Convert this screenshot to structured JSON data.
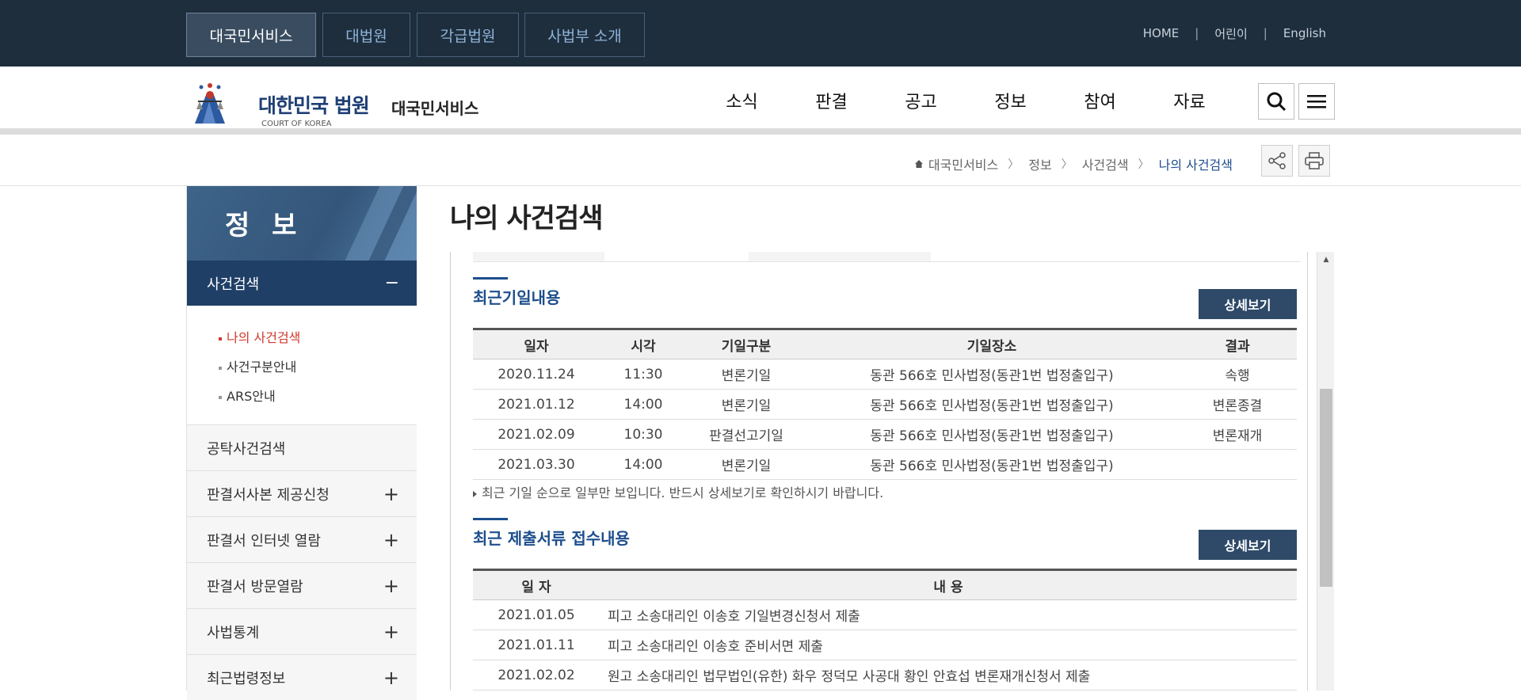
{
  "top_tabs": [
    "대국민서비스",
    "대법원",
    "각급법원",
    "사법부 소개"
  ],
  "utils": [
    "HOME",
    "어린이",
    "English"
  ],
  "logo": {
    "main": "대한민국 법원",
    "sub": "COURT OF KOREA",
    "service": "대국민서비스"
  },
  "gnb": [
    "소식",
    "판결",
    "공고",
    "정보",
    "참여",
    "자료"
  ],
  "breadcrumb": [
    "대국민서비스",
    "정보",
    "사건검색",
    "나의 사건검색"
  ],
  "sidebar": {
    "title": "정 보",
    "active": "사건검색",
    "active_toggle": "−",
    "sub_items": [
      "나의 사건검색",
      "사건구분안내",
      "ARS안내"
    ],
    "items": [
      {
        "label": "공탁사건검색",
        "toggle": ""
      },
      {
        "label": "판결서사본 제공신청",
        "toggle": "+"
      },
      {
        "label": "판결서 인터넷 열람",
        "toggle": "+"
      },
      {
        "label": "판결서 방문열람",
        "toggle": "+"
      },
      {
        "label": "사법통계",
        "toggle": "+"
      },
      {
        "label": "최근법령정보",
        "toggle": "+"
      }
    ]
  },
  "page_title": "나의 사건검색",
  "hearings": {
    "title": "최근기일내용",
    "button": "상세보기",
    "columns": [
      "일자",
      "시각",
      "기일구분",
      "기일장소",
      "결과"
    ],
    "rows": [
      [
        "2020.11.24",
        "11:30",
        "변론기일",
        "동관 566호 민사법정(동관1번 법정출입구)",
        "속행"
      ],
      [
        "2021.01.12",
        "14:00",
        "변론기일",
        "동관 566호 민사법정(동관1번 법정출입구)",
        "변론종결"
      ],
      [
        "2021.02.09",
        "10:30",
        "판결선고기일",
        "동관 566호 민사법정(동관1번 법정출입구)",
        "변론재개"
      ],
      [
        "2021.03.30",
        "14:00",
        "변론기일",
        "동관 566호 민사법정(동관1번 법정출입구)",
        ""
      ]
    ],
    "note": "최근 기일 순으로 일부만 보입니다. 반드시 상세보기로 확인하시기 바랍니다."
  },
  "filings": {
    "title": "최근 제출서류 접수내용",
    "button": "상세보기",
    "columns": [
      "일 자",
      "내 용"
    ],
    "rows": [
      [
        "2021.01.05",
        "피고 소송대리인 이송호 기일변경신청서 제출"
      ],
      [
        "2021.01.11",
        "피고 소송대리인 이송호 준비서면 제출"
      ],
      [
        "2021.02.02",
        "원고 소송대리인 법무법인(유한) 화우 정덕모 사공대 황인 안효섭 변론재개신청서 제출"
      ]
    ]
  },
  "colors": {
    "topbar": "#1e2e3d",
    "accent": "#1d4e8c",
    "sidebar_active": "#1f3f66",
    "button": "#2e4a68",
    "current_sub": "#d03a2c"
  }
}
